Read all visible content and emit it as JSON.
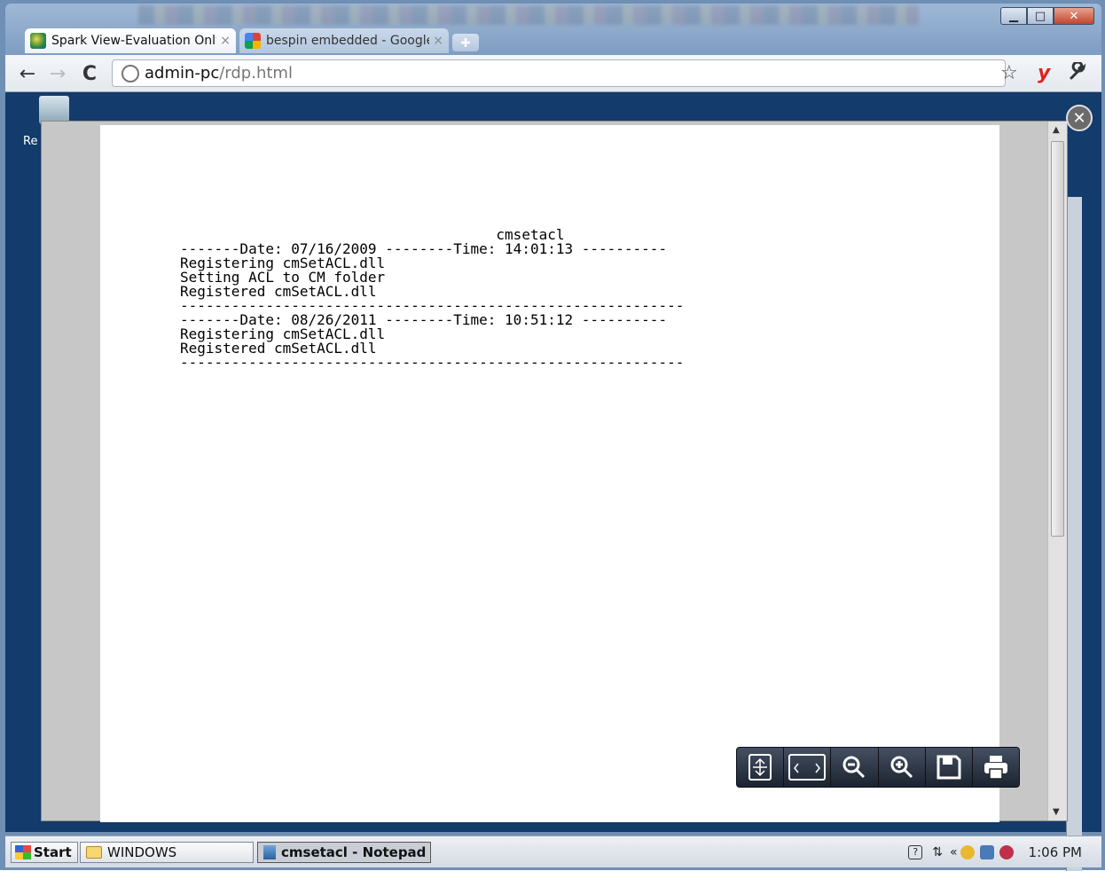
{
  "browser": {
    "tabs": [
      {
        "label": "Spark View-Evaluation Only",
        "close": "×"
      },
      {
        "label": "bespin embedded - Google",
        "close": "×"
      }
    ],
    "url_host": "admin-pc",
    "url_path": "/rdp.html"
  },
  "desktop": {
    "recycle_label": "Re"
  },
  "document": {
    "lines": [
      "                                     cmsetacl",
      "-------Date: 07/16/2009 --------Time: 14:01:13 ----------",
      "Registering cmSetACL.dll",
      "Setting ACL to CM folder",
      "Registered cmSetACL.dll",
      "-----------------------------------------------------------",
      "-------Date: 08/26/2011 --------Time: 10:51:12 ----------",
      "Registering cmSetACL.dll",
      "Registered cmSetACL.dll",
      "-----------------------------------------------------------"
    ]
  },
  "taskbar": {
    "start_label": "Start",
    "items": [
      {
        "label": "WINDOWS"
      },
      {
        "label": "cmsetacl - Notepad"
      }
    ],
    "tray_chevron": "«",
    "clock": "1:06 PM"
  }
}
